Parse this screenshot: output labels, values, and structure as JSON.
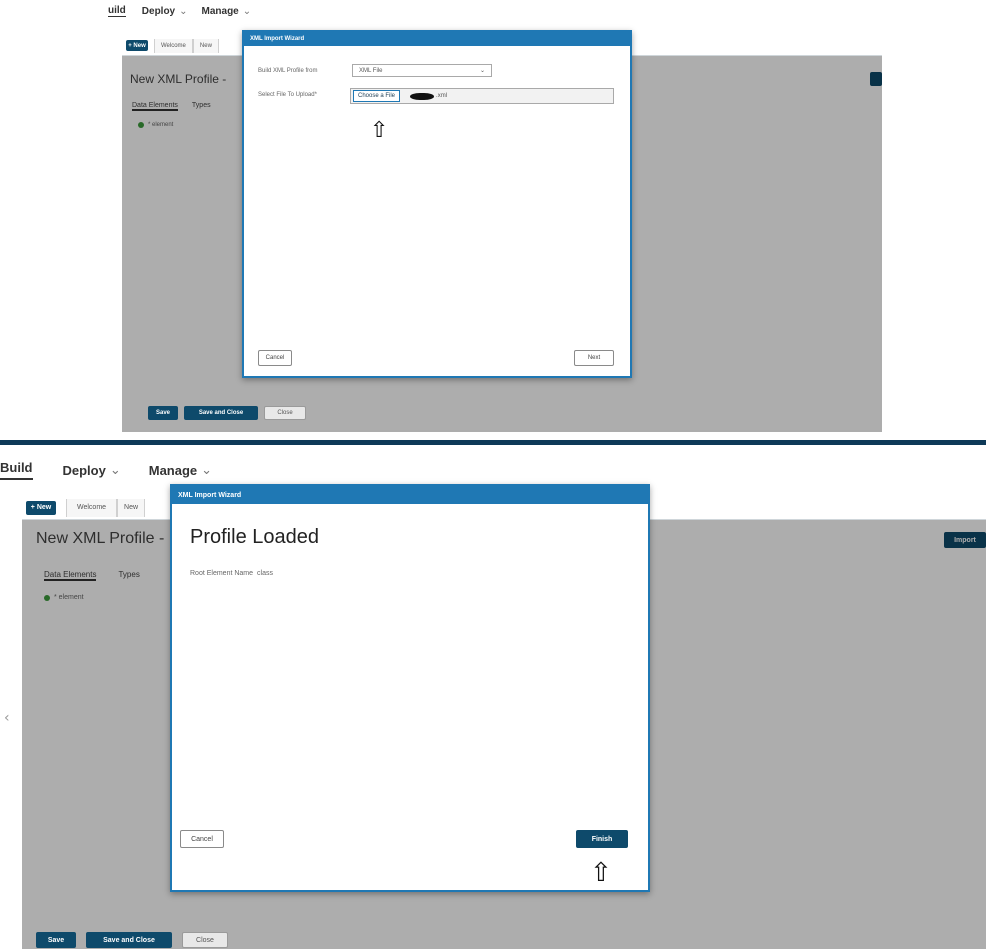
{
  "nav": {
    "build_label_cut": "uild",
    "build_label": "Build",
    "deploy_label": "Deploy",
    "manage_label": "Manage",
    "caret": "⌄"
  },
  "tabs": {
    "new_label": "+ New",
    "welcome_label": "Welcome",
    "new_tab_cut": "New"
  },
  "profile": {
    "title_cut": "New XML Profile -",
    "subtab_data": "Data Elements",
    "subtab_types": "Types",
    "tree_root": "* element",
    "import_label": "Import"
  },
  "wizard": {
    "header": "XML Import Wizard",
    "build_from_label": "Build XML Profile from",
    "build_from_value": "XML File",
    "file_label": "Select File To Upload*",
    "choose_label": "Choose a File",
    "file_suffix": ".xml",
    "cancel_label": "Cancel",
    "next_label": "Next",
    "loaded_title": "Profile Loaded",
    "root_name_label": "Root Element Name",
    "root_name_value": "class",
    "finish_label": "Finish"
  },
  "footer": {
    "save_label": "Save",
    "save_close_label": "Save and Close",
    "close_label": "Close"
  },
  "icons": {
    "arrow": "⇧",
    "left_handle": "‹",
    "dropdown": "⌄"
  },
  "colors": {
    "brand_dark": "#0e4a6b",
    "dialog_header": "#1f78b4",
    "leaf_green": "#3c9b3c"
  }
}
